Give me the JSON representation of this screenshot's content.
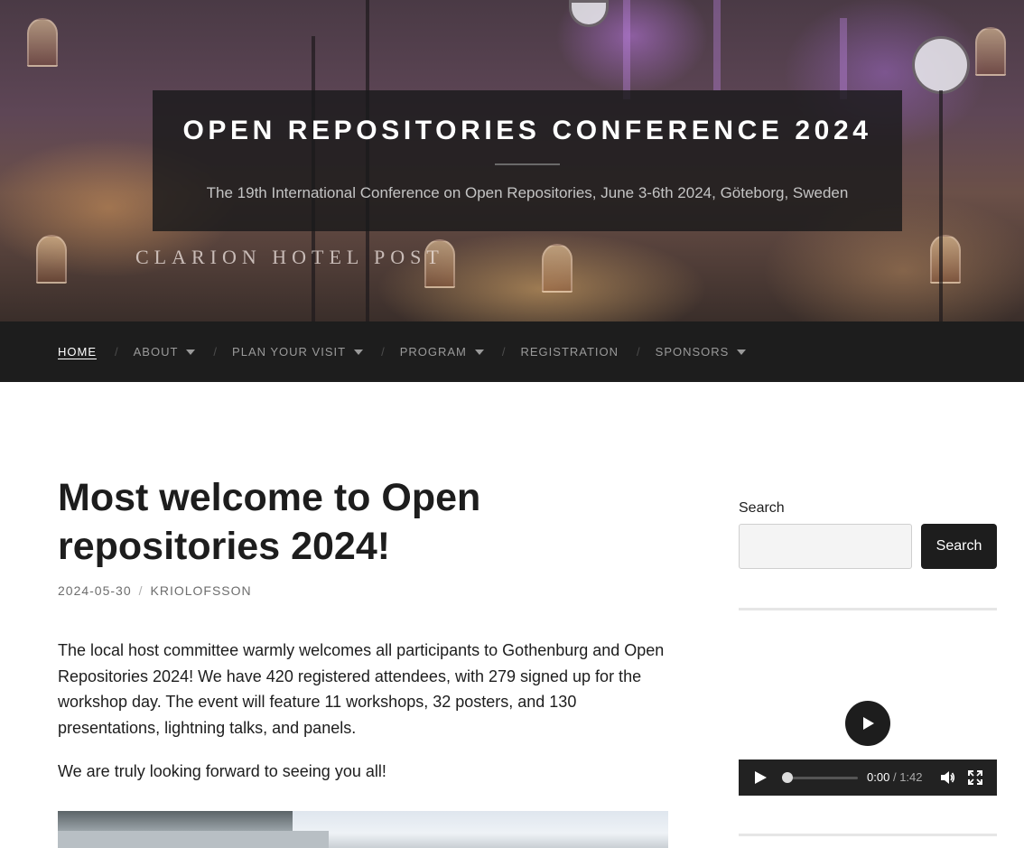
{
  "site": {
    "title": "OPEN REPOSITORIES CONFERENCE 2024",
    "description": "The 19th International Conference on Open Repositories, June 3-6th 2024, Göteborg, Sweden",
    "hero_sign": "CLARION HOTEL POST"
  },
  "nav": {
    "items": [
      {
        "label": "HOME",
        "active": true,
        "has_submenu": false
      },
      {
        "label": "ABOUT",
        "has_submenu": true
      },
      {
        "label": "PLAN YOUR VISIT",
        "has_submenu": true
      },
      {
        "label": "PROGRAM",
        "has_submenu": true
      },
      {
        "label": "REGISTRATION",
        "has_submenu": false
      },
      {
        "label": "SPONSORS",
        "has_submenu": true
      }
    ],
    "separator": "/"
  },
  "post": {
    "title": "Most welcome to Open repositories 2024!",
    "date": "2024-05-30",
    "meta_separator": "/",
    "author": "KRIOLOFSSON",
    "paragraphs": [
      "The local host committee warmly welcomes all participants to Gothenburg and Open Repositories 2024! We have 420 registered attendees, with 279 signed up for the workshop day. The event will feature 11 workshops, 32 posters, and 130 presentations, lightning talks, and panels.",
      "We are truly looking forward to seeing you all!"
    ]
  },
  "sidebar": {
    "search_label": "Search",
    "search_value": "",
    "search_button": "Search",
    "video": {
      "current_time": "0:00",
      "time_separator": "/",
      "duration": "1:42",
      "progress": 0
    }
  },
  "icons": {
    "play": "play-icon",
    "volume": "volume-icon",
    "fullscreen": "fullscreen-icon",
    "submenu": "caret-down-icon"
  },
  "colors": {
    "nav_bg": "#1d1d1d",
    "button_bg": "#1d1d1d",
    "title_box_bg": "#1a1a1b",
    "text": "#1d1d1d",
    "meta": "#6d6d6d"
  }
}
